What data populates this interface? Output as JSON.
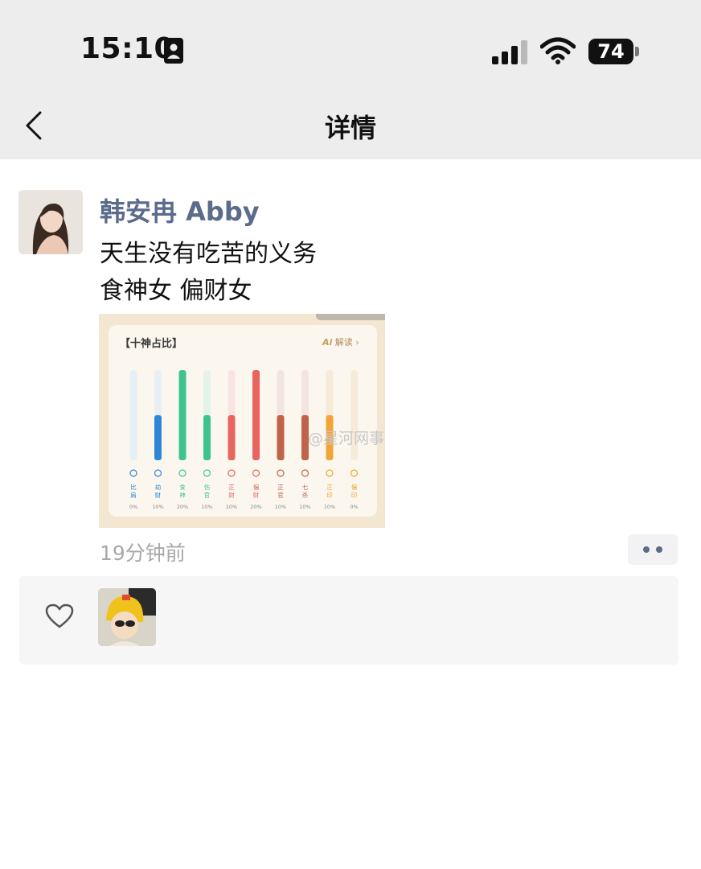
{
  "status_bar": {
    "time": "15:10",
    "battery": "74",
    "icons": [
      "id-card-icon",
      "cellular-signal-icon",
      "wifi-icon",
      "battery-icon"
    ]
  },
  "header": {
    "title": "详情",
    "back_icon": "chevron-left-icon"
  },
  "post": {
    "author": "韩安冉 Abby",
    "text_lines": [
      "天生没有吃苦的义务",
      "食神女 偏财女"
    ],
    "timestamp": "19分钟前",
    "more_icon": "more-dots-icon",
    "image": {
      "title": "【十神占比】",
      "ai_brand": "Ai",
      "ai_label": "解读 ›",
      "watermark": "@星河网事"
    }
  },
  "likes": {
    "heart_icon": "heart-outline-icon"
  },
  "chart_data": {
    "type": "bar",
    "title": "【十神占比】",
    "categories": [
      "比肩",
      "劫财",
      "食神",
      "伤官",
      "正财",
      "偏财",
      "正官",
      "七杀",
      "正印",
      "偏印"
    ],
    "values": [
      0,
      10,
      20,
      10,
      10,
      20,
      10,
      10,
      10,
      0
    ],
    "value_labels": [
      "0%",
      "10%",
      "20%",
      "10%",
      "10%",
      "20%",
      "10%",
      "10%",
      "10%",
      "0%"
    ],
    "ylim": [
      0,
      20
    ],
    "colors": [
      "#2f86d6",
      "#2f86d6",
      "#3ec48a",
      "#3ec48a",
      "#e8645e",
      "#e8645e",
      "#c0634a",
      "#c0634a",
      "#f2a536",
      "#f2a536"
    ],
    "track_colors": [
      "#e6eef6",
      "#e6eef6",
      "#e3f3ea",
      "#e3f3ea",
      "#f8e4e1",
      "#f8e4e1",
      "#f2e5df",
      "#f2e5df",
      "#f6ebd9",
      "#f6ebd9"
    ],
    "icons": [
      "cloud-icon",
      "wind-icon",
      "sprout-icon",
      "tree-icon",
      "sun-icon",
      "candle-icon",
      "mountain-icon",
      "bowl-icon",
      "torch-icon",
      "smile-icon"
    ]
  }
}
